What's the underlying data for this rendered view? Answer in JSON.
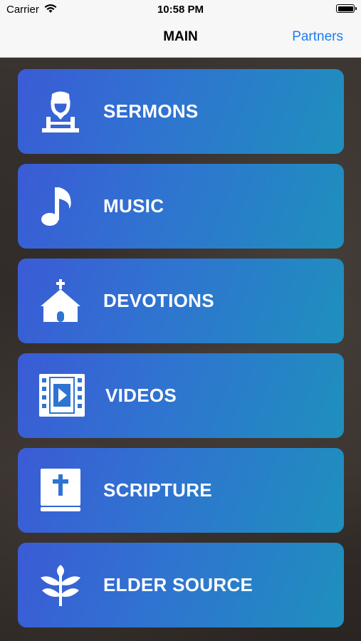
{
  "status_bar": {
    "carrier": "Carrier",
    "time": "10:58 PM"
  },
  "nav": {
    "title": "MAIN",
    "partners_label": "Partners",
    "link_color": "#1f7cf2"
  },
  "menu": {
    "items": [
      {
        "label": "SERMONS",
        "icon": "preacher-icon"
      },
      {
        "label": "MUSIC",
        "icon": "music-note-icon"
      },
      {
        "label": "DEVOTIONS",
        "icon": "church-icon"
      },
      {
        "label": "VIDEOS",
        "icon": "video-film-icon"
      },
      {
        "label": "SCRIPTURE",
        "icon": "bible-icon"
      },
      {
        "label": "ELDER SOURCE",
        "icon": "plant-icon"
      }
    ],
    "gradient": [
      "#3b5bd6",
      "#1e90bd"
    ]
  }
}
